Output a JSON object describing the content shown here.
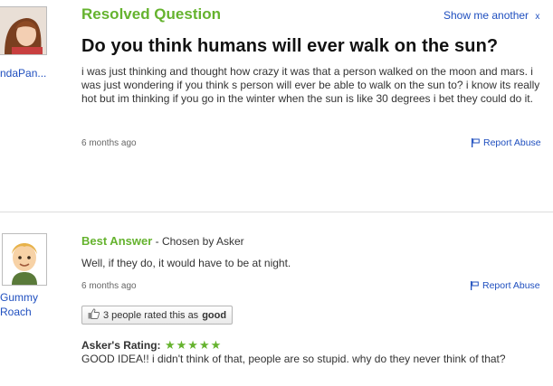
{
  "question": {
    "heading": "Resolved Question",
    "show_another": "Show me another",
    "show_another_close": "x",
    "asker_name": "ndaPan...",
    "title": "Do you think humans will ever walk on the sun?",
    "body": "i was just thinking and thought how crazy it was that a person walked on the moon and mars. i was just wondering if you think s person will ever be able to walk on the sun to? i know its really hot but im thinking if you go in the winter when the sun is like 30 degrees i bet they could do it.",
    "timestamp": "6 months ago",
    "report_label": "Report Abuse"
  },
  "answer": {
    "best_label": "Best Answer",
    "chosen_by": " - Chosen by Asker",
    "answerer_name": "Gummy Roach",
    "text": "Well, if they do, it would have to be at night.",
    "timestamp": "6 months ago",
    "report_label": "Report Abuse",
    "rating_count_text": "3 people rated this as",
    "rating_value": "good",
    "asker_rating_label": "Asker's Rating:",
    "asker_rating_stars": "★★★★★",
    "asker_rating_value": 5,
    "asker_comment": "GOOD IDEA!! i didn't think of that, people are so stupid. why do they never think of that?"
  },
  "colors": {
    "green": "#65b32e",
    "link_blue": "#1f4fbf"
  }
}
